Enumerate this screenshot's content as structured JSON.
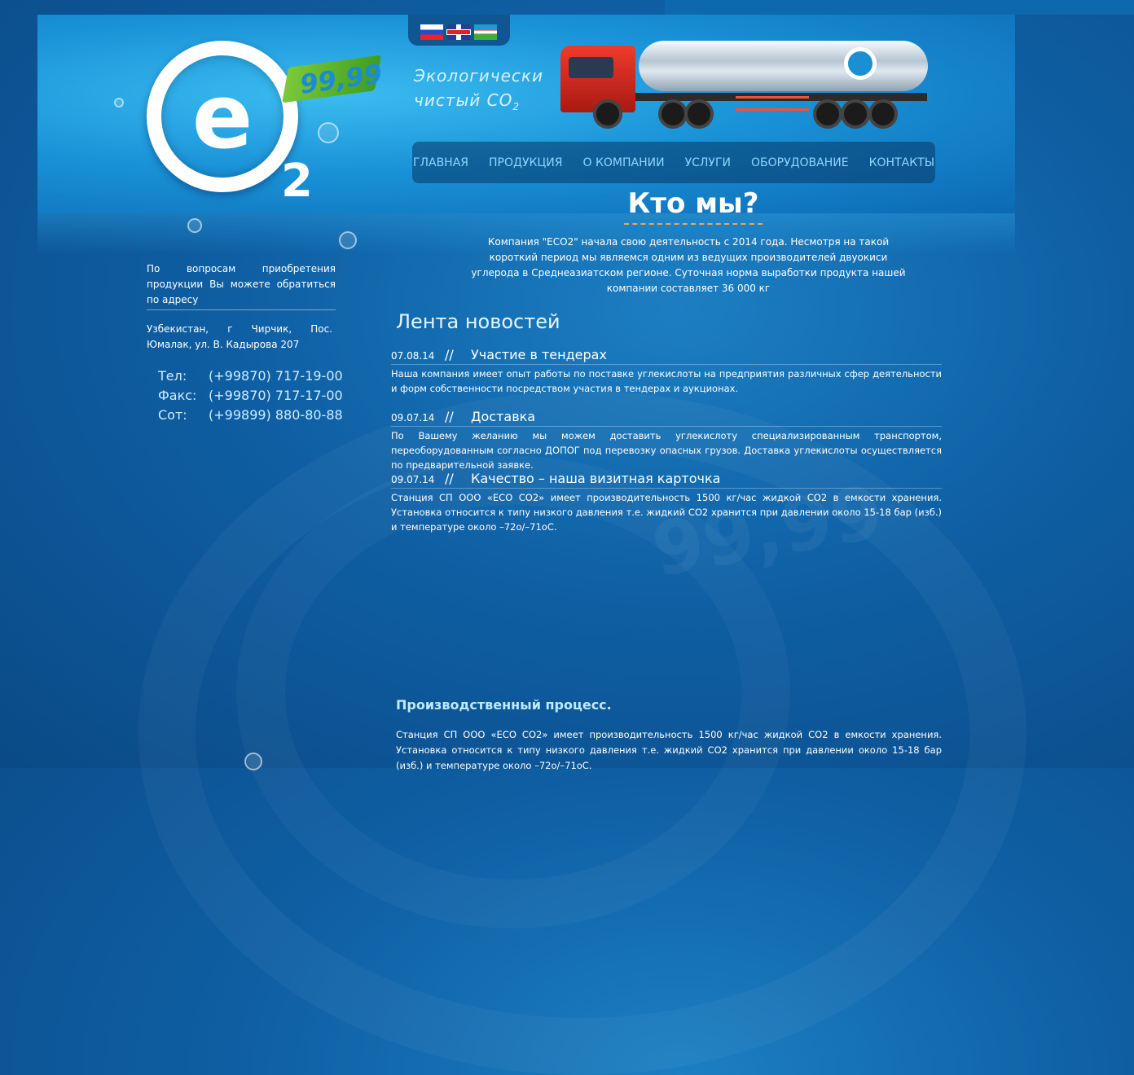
{
  "header": {
    "flags": [
      {
        "name": "ru-flag-icon",
        "lang": "ru"
      },
      {
        "name": "en-flag-icon",
        "lang": "en"
      },
      {
        "name": "uz-flag-icon",
        "lang": "uz"
      }
    ],
    "logo_badge": "99,99",
    "logo_sub": "2",
    "slogan_line1": "Экологически",
    "slogan_line2": "чистый СО",
    "slogan_sub": "2"
  },
  "nav": {
    "items": [
      "ГЛАВНАЯ",
      "ПРОДУКЦИЯ",
      "О КОМПАНИИ",
      "УСЛУГИ",
      "ОБОРУДОВАНИЕ",
      "КОНТАКТЫ"
    ]
  },
  "who": {
    "title": "Кто мы?",
    "text": "Компания \"ECO2\" начала свою деятельность с 2014 года. Несмотря на такой короткий период мы являемся одним из ведущих производителей двуокиси углерода в Среднеазиатском регионе. Суточная норма выработки продукта нашей компании составляет 36 000 кг"
  },
  "sidebar": {
    "intro": "По вопросам приобретения продукции Вы можете обратиться по адресу",
    "address": "Узбекистан, г Чирчик, Пос. Юмалак, ул. В. Кадырова 207",
    "contacts": [
      {
        "label": "Тел:",
        "value": "(+99870) 717-19-00"
      },
      {
        "label": "Факс:",
        "value": "(+99870) 717-17-00"
      },
      {
        "label": "Сот:",
        "value": "(+99899) 880-80-88"
      }
    ]
  },
  "news": {
    "heading": "Лента новостей",
    "separator": "//",
    "items": [
      {
        "date": "07.08.14",
        "title": "Участие в тендерах",
        "text": "Наша компания имеет опыт работы по поставке углекислоты на предприятия различных сфер деятельности и форм собственности посредством участия в тендерах и аукционах."
      },
      {
        "date": "09.07.14",
        "title": "Доставка",
        "text": "По Вашему желанию мы можем доставить углекислоту  специализированным транспортом, переоборудованным согласно ДОПОГ под перевозку опасных грузов. Доставка углекислоты   осуществляется по предварительной заявке."
      },
      {
        "date": "09.07.14",
        "title": "Качество – наша визитная карточка",
        "text": "Станция СП ООО «ECO CO2» имеет производительность 1500 кг/час жидкой СО2 в емкости хранения. Установка относится к типу низкого давления т.е. жидкий СО2 хранится при давлении около 15-18 бар (изб.) и температуре около –72о/–71оС."
      }
    ]
  },
  "process": {
    "title": "Производственный процесс.",
    "text": "Станция СП ООО «ECO CO2» имеет производительность 1500 кг/час жидкой СО2 в емкости хранения. Установка относится к типу низкого давления т.е. жидкий СО2 хранится при давлении около 15-18 бар (изб.) и температуре около –72о/–71оС."
  },
  "colors": {
    "background": "#0f5fa4",
    "nav_text": "#8fd6ff",
    "accent_dash": "#f2a74b",
    "badge_green": "#5cb52e"
  }
}
